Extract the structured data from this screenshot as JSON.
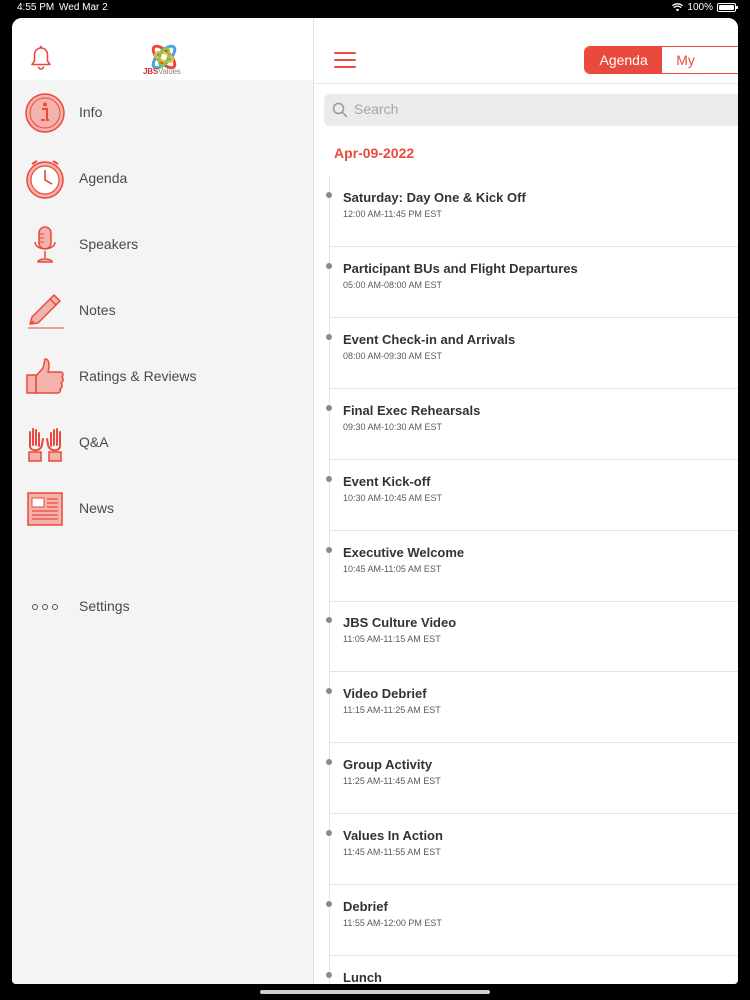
{
  "status": {
    "time": "4:55 PM",
    "date": "Wed Mar 2",
    "battery": "100%",
    "battery_level": 1.0
  },
  "logo": {
    "bold": "JBS",
    "light": "Values"
  },
  "sidebar": {
    "items": [
      {
        "label": "Info",
        "icon": "info-icon"
      },
      {
        "label": "Agenda",
        "icon": "clock-icon"
      },
      {
        "label": "Speakers",
        "icon": "microphone-icon"
      },
      {
        "label": "Notes",
        "icon": "pen-icon"
      },
      {
        "label": "Ratings & Reviews",
        "icon": "thumbs-up-icon"
      },
      {
        "label": "Q&A",
        "icon": "raised-hands-icon"
      },
      {
        "label": "News",
        "icon": "newspaper-icon"
      }
    ],
    "settings": {
      "label": "Settings",
      "icon": "more-dots-icon"
    }
  },
  "main": {
    "tabs": [
      {
        "label": "Agenda",
        "active": true
      },
      {
        "label": "My agenda",
        "active": false
      }
    ],
    "search": {
      "placeholder": "Search"
    },
    "date": "Apr-09-2022",
    "events": [
      {
        "title": "Saturday: Day One & Kick Off",
        "time": "12:00 AM-11:45 PM EST"
      },
      {
        "title": "Participant BUs and Flight Departures",
        "time": "05:00 AM-08:00 AM EST"
      },
      {
        "title": "Event Check-in and Arrivals",
        "time": "08:00 AM-09:30 AM EST"
      },
      {
        "title": "Final Exec Rehearsals",
        "time": "09:30 AM-10:30 AM EST"
      },
      {
        "title": "Event Kick-off",
        "time": "10:30 AM-10:45 AM EST"
      },
      {
        "title": "Executive Welcome",
        "time": "10:45 AM-11:05 AM EST"
      },
      {
        "title": "JBS Culture Video",
        "time": "11:05 AM-11:15 AM EST"
      },
      {
        "title": "Video Debrief",
        "time": "11:15 AM-11:25 AM EST"
      },
      {
        "title": "Group Activity",
        "time": "11:25 AM-11:45 AM EST"
      },
      {
        "title": "Values In Action",
        "time": "11:45 AM-11:55 AM EST"
      },
      {
        "title": "Debrief",
        "time": "11:55 AM-12:00 PM EST"
      },
      {
        "title": "Lunch",
        "time": ""
      }
    ]
  },
  "colors": {
    "accent": "#ea4a3d",
    "sidebar_bg": "#f4f4f4",
    "text": "#333333"
  }
}
